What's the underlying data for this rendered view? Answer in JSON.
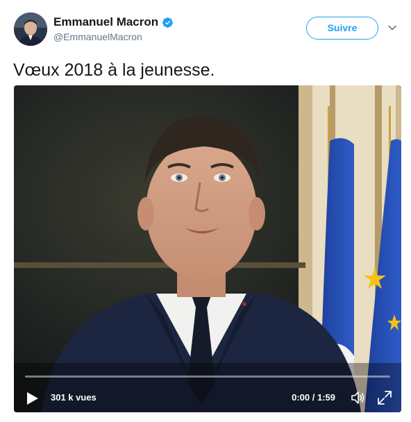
{
  "author": {
    "display_name": "Emmanuel Macron",
    "handle": "@EmmanuelMacron",
    "verified": true
  },
  "follow_button": {
    "label": "Suivre"
  },
  "tweet": {
    "text": "Vœux 2018 à la jeunesse."
  },
  "video": {
    "views_label": "301 k vues",
    "time_label": "0:00 / 1:59",
    "progress_fraction": 0.0
  },
  "icons": {
    "verified": "verified-badge-icon",
    "more": "chevron-down-icon",
    "play": "play-icon",
    "volume": "volume-icon",
    "fullscreen": "fullscreen-icon"
  },
  "colors": {
    "accent": "#1da1f2",
    "text": "#14171a",
    "secondary_text": "#657786"
  }
}
